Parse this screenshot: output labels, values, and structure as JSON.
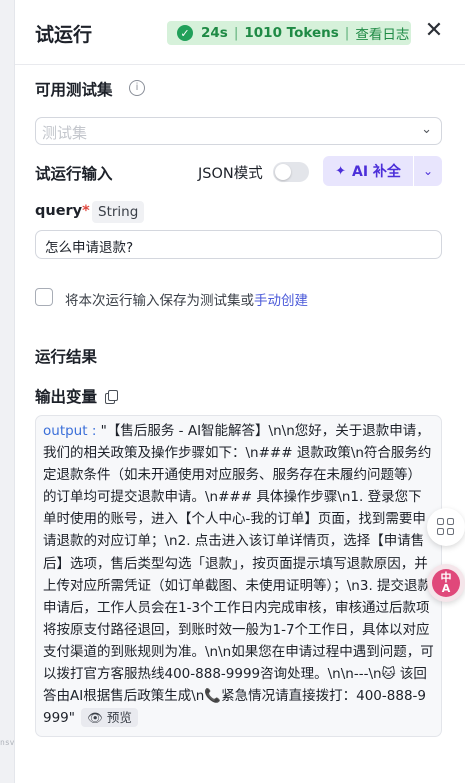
{
  "header": {
    "title": "试运行",
    "status": {
      "duration": "24s",
      "tokens": "1010 Tokens",
      "log_link": "查看日志"
    },
    "close_icon": "close-icon"
  },
  "test_set": {
    "title": "可用测试集",
    "info_icon": "info-icon",
    "placeholder": "测试集"
  },
  "input": {
    "title": "试运行输入",
    "json_mode_label": "JSON模式",
    "json_mode_on": false,
    "ai_button_label": "AI 补全",
    "param": {
      "name": "query",
      "required_mark": "*",
      "type": "String",
      "value": "怎么申请退款?"
    },
    "save_text": "将本次运行输入保存为测试集或",
    "save_link": "手动创建"
  },
  "result": {
    "title": "运行结果",
    "output_label": "输出变量",
    "output_key": "output",
    "output_sep": " : ",
    "output_value": "\"【售后服务 - AI智能解答】\\n\\n您好，关于退款申请，我们的相关政策及操作步骤如下：\\n### 退款政策\\n符合服务约定退款条件（如未开通使用对应服务、服务存在未履约问题等）的订单均可提交退款申请。\\n### 具体操作步骤\\n1. 登录您下单时使用的账号，进入【个人中心-我的订单】页面，找到需要申请退款的对应订单；\\n2. 点击进入该订单详情页，选择【申请售后】选项，售后类型勾选「退款」，按页面提示填写退款原因，并上传对应所需凭证（如订单截图、未使用证明等）；\\n3. 提交退款申请后，工作人员会在1-3个工作日内完成审核，审核通过后款项将按原支付路径退回，到账时效一般为1-7个工作日，具体以对应支付渠道的到账规则为准。\\n\\n如果您在申请过程中遇到问题，可以拨打官方客服热线400-888-9999咨询处理。\\n\\n---\\n🐱 该回答由AI根据售后政策生成\\n📞紧急情况请直接拨打：400-888-9999\"",
    "preview_label": "预览"
  },
  "side": {
    "edge_tick": "nsv"
  },
  "colors": {
    "accent": "#4c2fd9",
    "success": "#21a05a",
    "link": "#4c5bd9"
  }
}
